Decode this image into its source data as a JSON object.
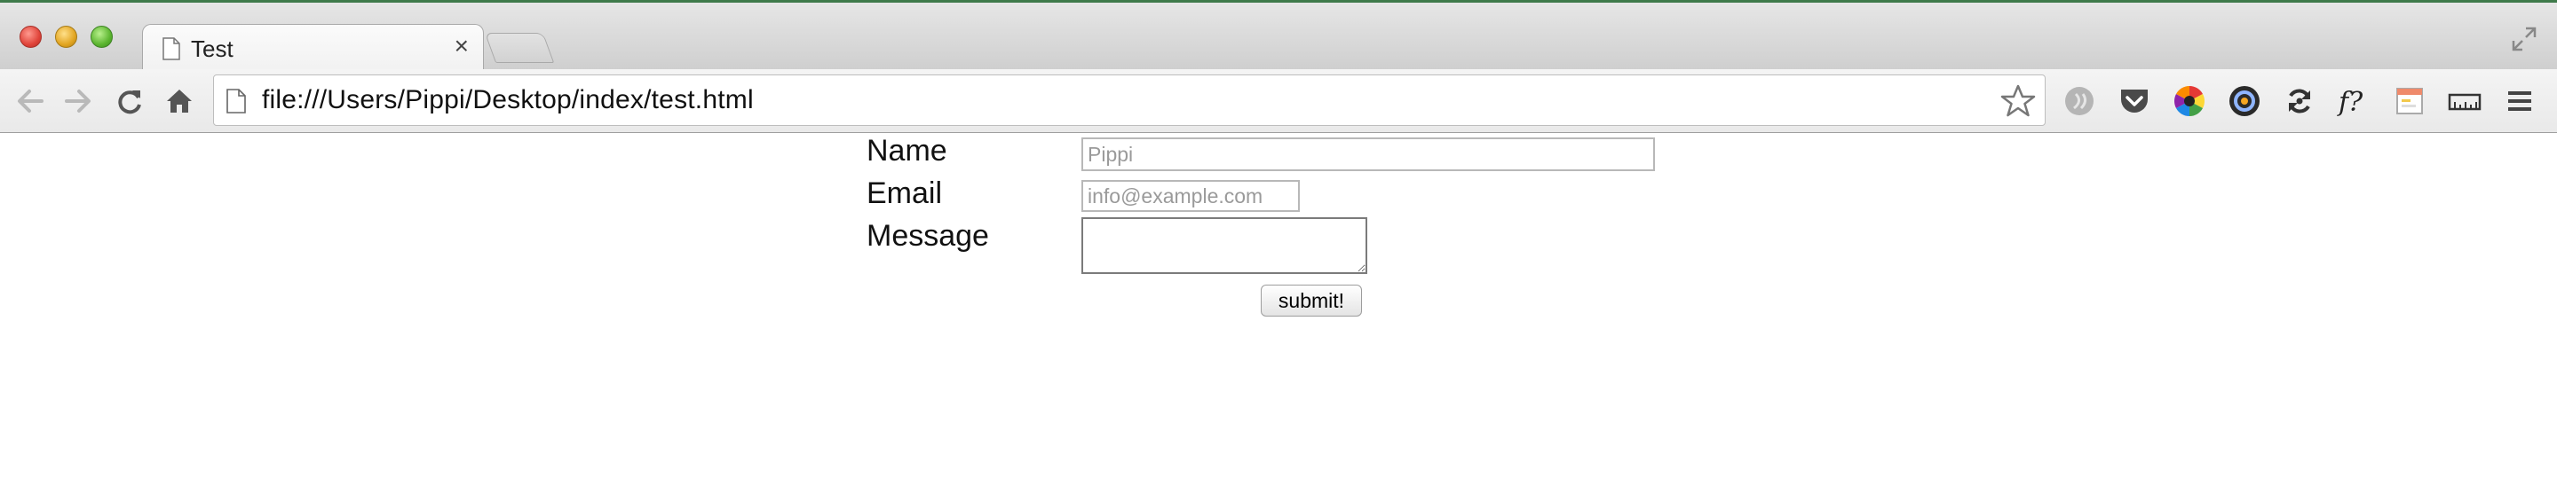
{
  "browser": {
    "tab_title": "Test",
    "tab_close": "×",
    "url": "file:///Users/Pippi/Desktop/index/test.html",
    "icons": [
      "back-icon",
      "forward-icon",
      "reload-icon",
      "home-icon",
      "page-icon",
      "star-icon",
      "pocket-icon",
      "color-wheel-icon",
      "tint-icon",
      "sync-icon",
      "font-icon",
      "note-icon",
      "ruler-icon",
      "menu-icon"
    ],
    "accent_colors": {
      "close": "#e0443a",
      "minimize": "#e2a521",
      "zoom": "#5bb52f"
    }
  },
  "form": {
    "name_label": "Name",
    "name_placeholder": "Pippi",
    "email_label": "Email",
    "email_placeholder": "info@example.com",
    "message_label": "Message",
    "submit_label": "submit!"
  }
}
